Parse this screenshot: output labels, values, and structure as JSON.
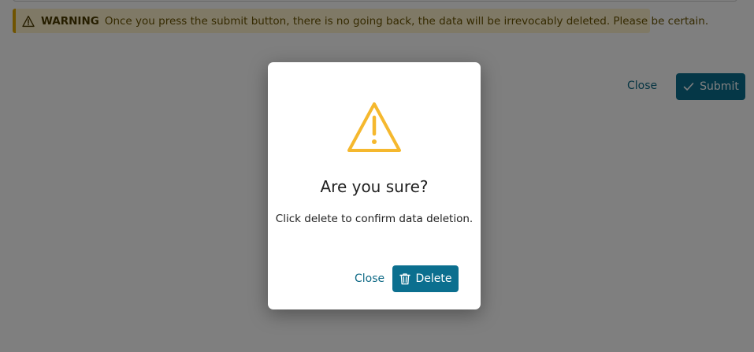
{
  "warning": {
    "title": "WARNING",
    "message": "Once you press the submit button, there is no going back, the data will be irrevocably deleted. Please be certain.",
    "icon": "warning-triangle-icon"
  },
  "page_actions": {
    "close_label": "Close",
    "submit_label": "Submit",
    "submit_icon": "check-icon"
  },
  "modal": {
    "icon": "warning-triangle-icon",
    "title": "Are you sure?",
    "body": "Click delete to confirm data deletion.",
    "close_label": "Close",
    "delete_label": "Delete",
    "delete_icon": "trash-icon"
  },
  "colors": {
    "primary": "#0b6f8f",
    "link": "#0f6a86",
    "warning_bg": "#fff3cd",
    "warning_border": "#e0a800",
    "warning_icon": "#f5b82e",
    "backdrop": "rgba(0,0,0,0.5)"
  }
}
